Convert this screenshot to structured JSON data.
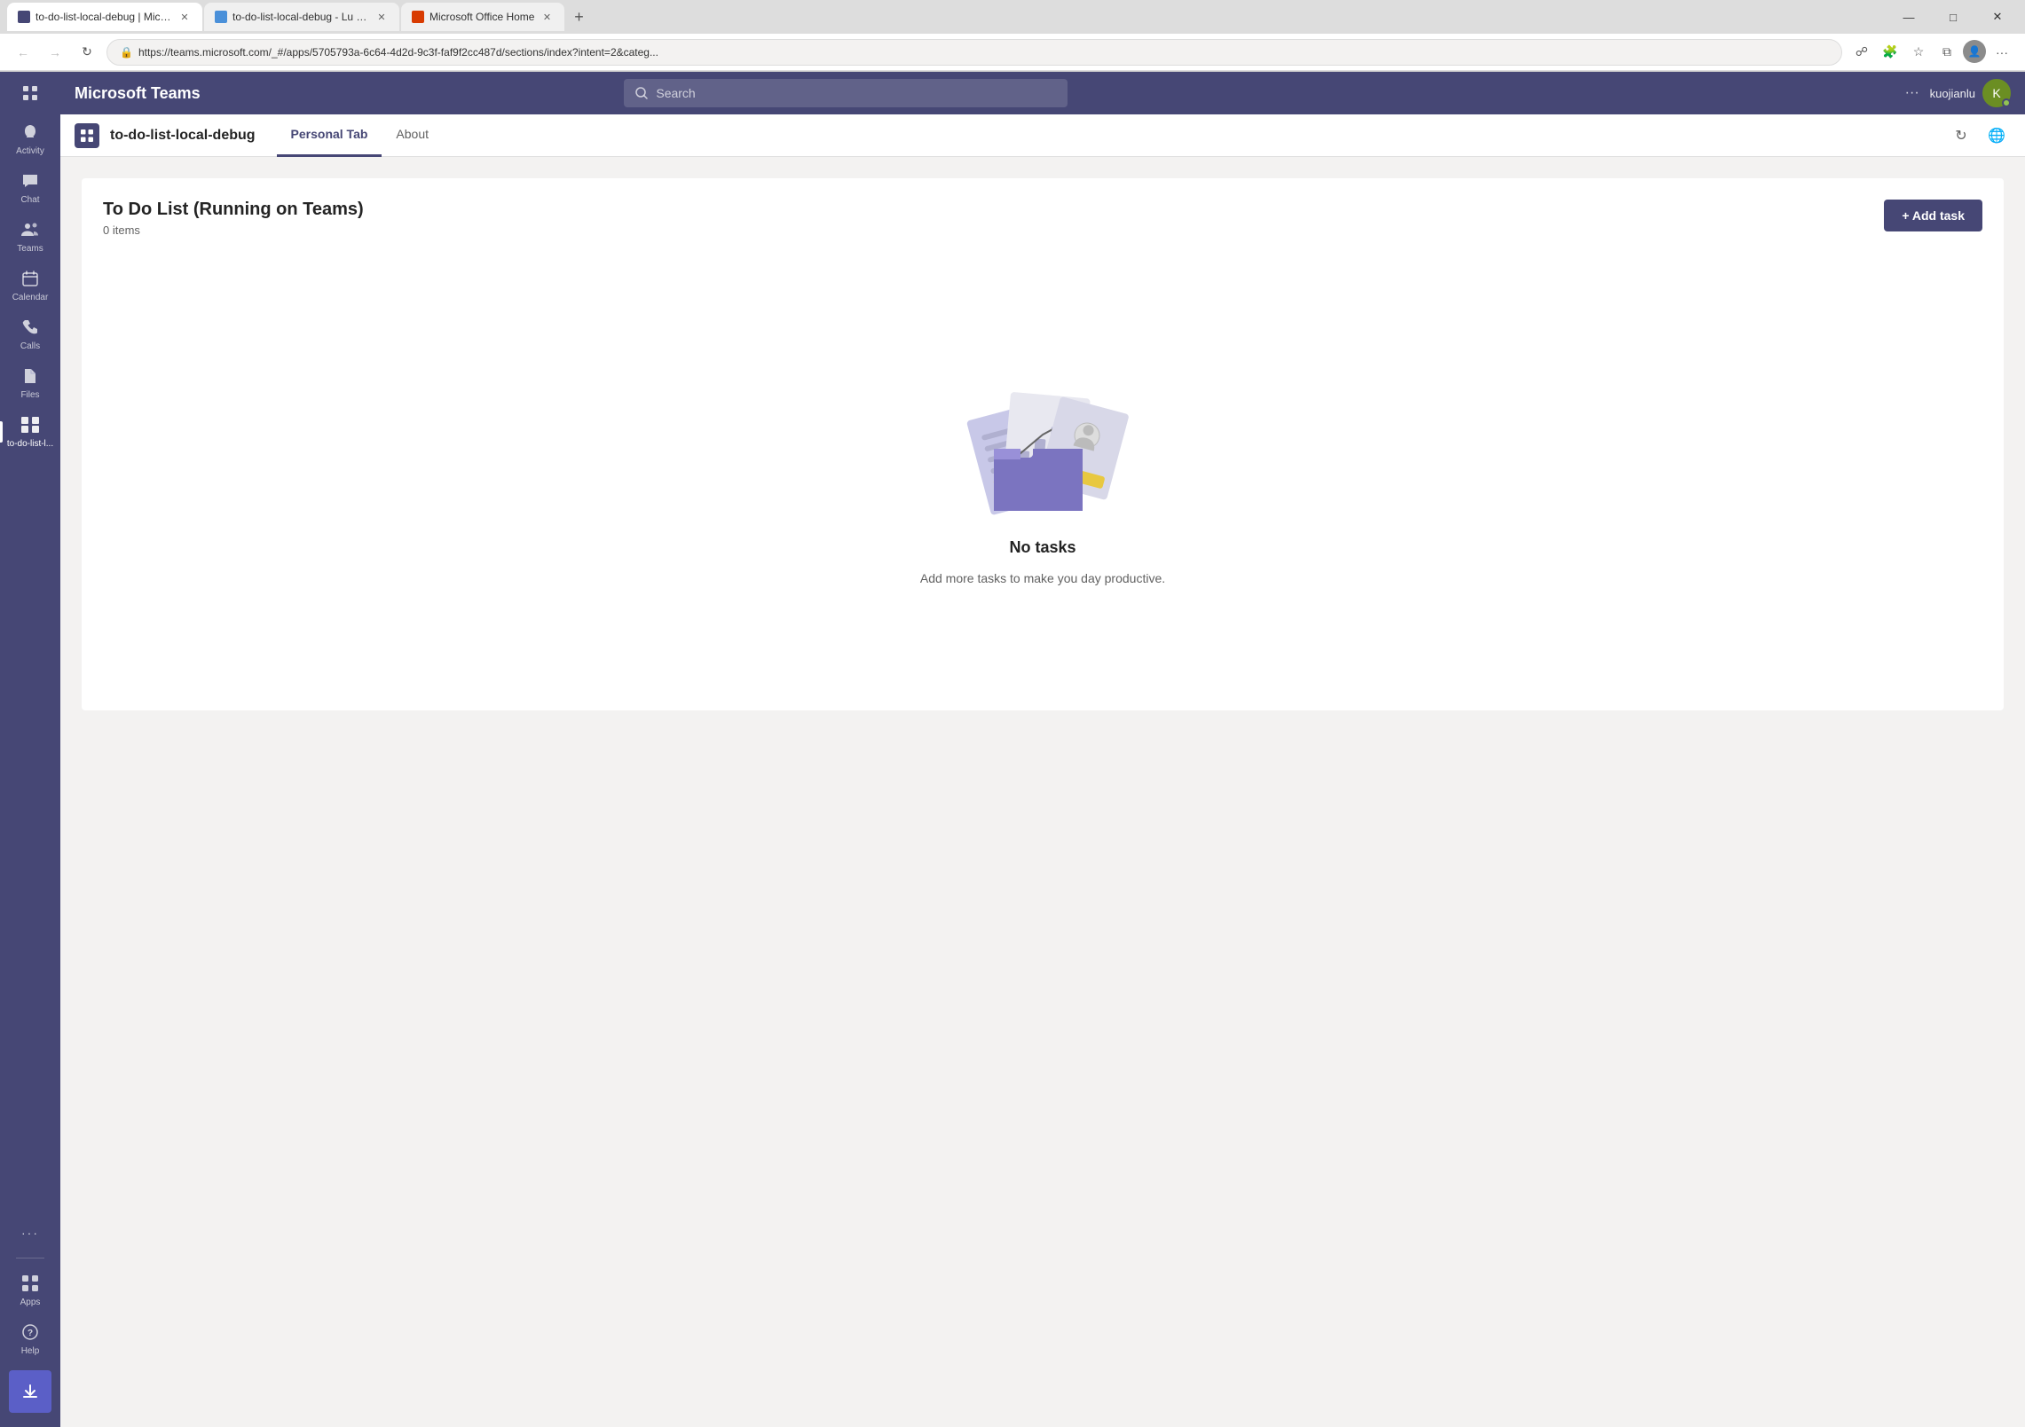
{
  "browser": {
    "tabs": [
      {
        "id": "tab1",
        "title": "to-do-list-local-debug | Microso...",
        "favicon_color": "#464775",
        "active": true
      },
      {
        "id": "tab2",
        "title": "to-do-list-local-debug - Lu Kuoj...",
        "favicon_color": "#4a90d9",
        "active": false
      },
      {
        "id": "tab3",
        "title": "Microsoft Office Home",
        "favicon_color": "#d83b01",
        "active": false
      }
    ],
    "new_tab_label": "+",
    "window_controls": {
      "minimize": "—",
      "maximize": "□",
      "close": "✕"
    },
    "url": "https://teams.microsoft.com/_#/apps/5705793a-6c64-4d2d-9c3f-faf9f2cc487d/sections/index?intent=2&categ...",
    "nav": {
      "back_disabled": true,
      "forward_disabled": true
    }
  },
  "teams": {
    "header": {
      "logo": "Microsoft Teams",
      "search_placeholder": "Search",
      "more_options_label": "···",
      "username": "kuojianlu"
    },
    "sidebar": {
      "grid_icon": "⊞",
      "items": [
        {
          "id": "activity",
          "label": "Activity",
          "icon": "🔔"
        },
        {
          "id": "chat",
          "label": "Chat",
          "icon": "💬"
        },
        {
          "id": "teams",
          "label": "Teams",
          "icon": "👥"
        },
        {
          "id": "calendar",
          "label": "Calendar",
          "icon": "📅"
        },
        {
          "id": "calls",
          "label": "Calls",
          "icon": "📞"
        },
        {
          "id": "files",
          "label": "Files",
          "icon": "📄"
        },
        {
          "id": "todo",
          "label": "to-do-list-l...",
          "icon": "🧩",
          "active": true
        }
      ],
      "bottom_items": [
        {
          "id": "more",
          "label": "···",
          "icon": "···"
        },
        {
          "id": "apps",
          "label": "Apps",
          "icon": "⊞"
        },
        {
          "id": "help",
          "label": "Help",
          "icon": "?"
        }
      ],
      "download_icon": "⬇"
    },
    "app": {
      "icon": "🧩",
      "title": "to-do-list-local-debug",
      "tabs": [
        {
          "id": "personal",
          "label": "Personal Tab",
          "active": true
        },
        {
          "id": "about",
          "label": "About",
          "active": false
        }
      ],
      "actions": {
        "refresh": "↻",
        "globe": "🌐"
      }
    },
    "todo": {
      "heading": "To Do List (Running on Teams)",
      "item_count": "0 items",
      "add_button": "+ Add task",
      "empty_state": {
        "title": "No tasks",
        "subtitle": "Add more tasks to make you day productive."
      }
    }
  }
}
